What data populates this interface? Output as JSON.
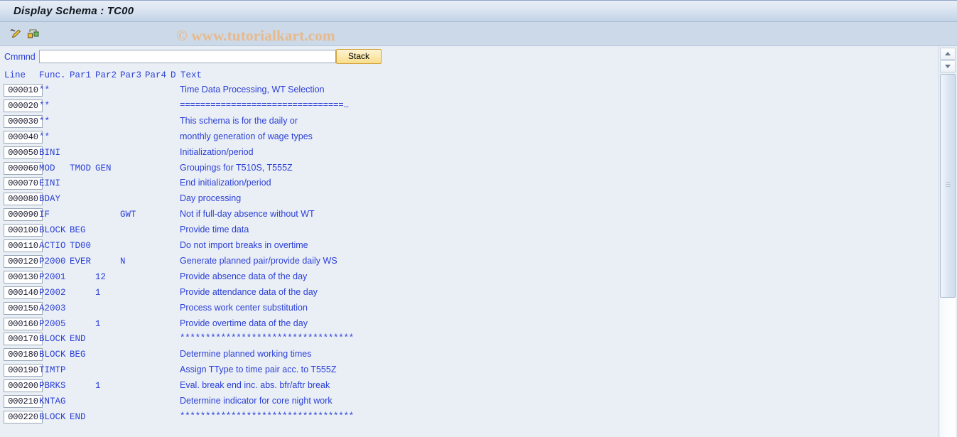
{
  "window": {
    "title": "Display Schema : TC00"
  },
  "toolbar": {
    "icons": [
      {
        "name": "edit-pencil-icon",
        "label": "Display <-> Change"
      },
      {
        "name": "hierarchy-structure-icon",
        "label": "Structure"
      }
    ]
  },
  "watermark": {
    "text": "© www.tutorialkart.com",
    "color": "#e8b98a"
  },
  "command": {
    "label": "Cmmnd",
    "value": "",
    "placeholder": "",
    "stack_label": "Stack"
  },
  "colors": {
    "title_bar": "#c2d3e6",
    "toolbar": "#ccd9e8",
    "content_bg": "#eaeff6",
    "text_blue": "#2b3fd6",
    "stack_border": "#d2a23c"
  },
  "grid": {
    "columns": [
      {
        "key": "line",
        "label": "Line"
      },
      {
        "key": "func",
        "label": "Func."
      },
      {
        "key": "par1",
        "label": "Par1"
      },
      {
        "key": "par2",
        "label": "Par2"
      },
      {
        "key": "par3",
        "label": "Par3"
      },
      {
        "key": "par4",
        "label": "Par4"
      },
      {
        "key": "d",
        "label": "D"
      },
      {
        "key": "text",
        "label": "Text"
      }
    ],
    "rows": [
      {
        "line": "000010",
        "func": "**",
        "par1": "",
        "par2": "",
        "par3": "",
        "par4": "",
        "d": "",
        "text": "Time Data Processing, WT Selection",
        "mono": false
      },
      {
        "line": "000020",
        "func": "**",
        "par1": "",
        "par2": "",
        "par3": "",
        "par4": "",
        "d": "",
        "text": "================================…",
        "mono": true
      },
      {
        "line": "000030",
        "func": "**",
        "par1": "",
        "par2": "",
        "par3": "",
        "par4": "",
        "d": "",
        "text": "This schema is for the daily or",
        "mono": false
      },
      {
        "line": "000040",
        "func": "**",
        "par1": "",
        "par2": "",
        "par3": "",
        "par4": "",
        "d": "",
        "text": "monthly generation of wage types",
        "mono": false
      },
      {
        "line": "000050",
        "func": "BINI",
        "par1": "",
        "par2": "",
        "par3": "",
        "par4": "",
        "d": "",
        "text": "Initialization/period",
        "mono": false
      },
      {
        "line": "000060",
        "func": "MOD",
        "par1": "TMOD",
        "par2": "GEN",
        "par3": "",
        "par4": "",
        "d": "",
        "text": "Groupings for T510S, T555Z",
        "mono": false
      },
      {
        "line": "000070",
        "func": "EINI",
        "par1": "",
        "par2": "",
        "par3": "",
        "par4": "",
        "d": "",
        "text": "End initialization/period",
        "mono": false
      },
      {
        "line": "000080",
        "func": "BDAY",
        "par1": "",
        "par2": "",
        "par3": "",
        "par4": "",
        "d": "",
        "text": "Day processing",
        "mono": false
      },
      {
        "line": "000090",
        "func": "IF",
        "par1": "",
        "par2": "",
        "par3": "GWT",
        "par4": "",
        "d": "",
        "text": "Not if full-day absence without WT",
        "mono": false
      },
      {
        "line": "000100",
        "func": "BLOCK",
        "par1": "BEG",
        "par2": "",
        "par3": "",
        "par4": "",
        "d": "",
        "text": "Provide time data",
        "mono": false
      },
      {
        "line": "000110",
        "func": "ACTIO",
        "par1": "TD00",
        "par2": "",
        "par3": "",
        "par4": "",
        "d": "",
        "text": "Do not import breaks in overtime",
        "mono": false
      },
      {
        "line": "000120",
        "func": "P2000",
        "par1": "EVER",
        "par2": "",
        "par3": "N",
        "par4": "",
        "d": "",
        "text": "Generate planned pair/provide daily WS",
        "mono": false
      },
      {
        "line": "000130",
        "func": "P2001",
        "par1": "",
        "par2": "12",
        "par3": "",
        "par4": "",
        "d": "",
        "text": "Provide absence data of the day",
        "mono": false
      },
      {
        "line": "000140",
        "func": "P2002",
        "par1": "",
        "par2": "1",
        "par3": "",
        "par4": "",
        "d": "",
        "text": "Provide attendance data of the day",
        "mono": false
      },
      {
        "line": "000150",
        "func": "A2003",
        "par1": "",
        "par2": "",
        "par3": "",
        "par4": "",
        "d": "",
        "text": "Process work center substitution",
        "mono": false
      },
      {
        "line": "000160",
        "func": "P2005",
        "par1": "",
        "par2": "1",
        "par3": "",
        "par4": "",
        "d": "",
        "text": "Provide overtime data of the day",
        "mono": false
      },
      {
        "line": "000170",
        "func": "BLOCK",
        "par1": "END",
        "par2": "",
        "par3": "",
        "par4": "",
        "d": "",
        "text": "**********************************",
        "mono": true
      },
      {
        "line": "000180",
        "func": "BLOCK",
        "par1": "BEG",
        "par2": "",
        "par3": "",
        "par4": "",
        "d": "",
        "text": "Determine planned working times",
        "mono": false
      },
      {
        "line": "000190",
        "func": "TIMTP",
        "par1": "",
        "par2": "",
        "par3": "",
        "par4": "",
        "d": "",
        "text": "Assign TType to time pair acc. to T555Z",
        "mono": false
      },
      {
        "line": "000200",
        "func": "PBRKS",
        "par1": "",
        "par2": "1",
        "par3": "",
        "par4": "",
        "d": "",
        "text": "Eval. break end inc. abs. bfr/aftr break",
        "mono": false
      },
      {
        "line": "000210",
        "func": "KNTAG",
        "par1": "",
        "par2": "",
        "par3": "",
        "par4": "",
        "d": "",
        "text": "Determine indicator for core night work",
        "mono": false
      },
      {
        "line": "000220",
        "func": "BLOCK",
        "par1": "END",
        "par2": "",
        "par3": "",
        "par4": "",
        "d": "",
        "text": "**********************************",
        "mono": true
      }
    ]
  },
  "scrollbar": {
    "up_arrow": "scroll-up",
    "down_arrow": "scroll-down",
    "thumb": "scroll-thumb"
  }
}
